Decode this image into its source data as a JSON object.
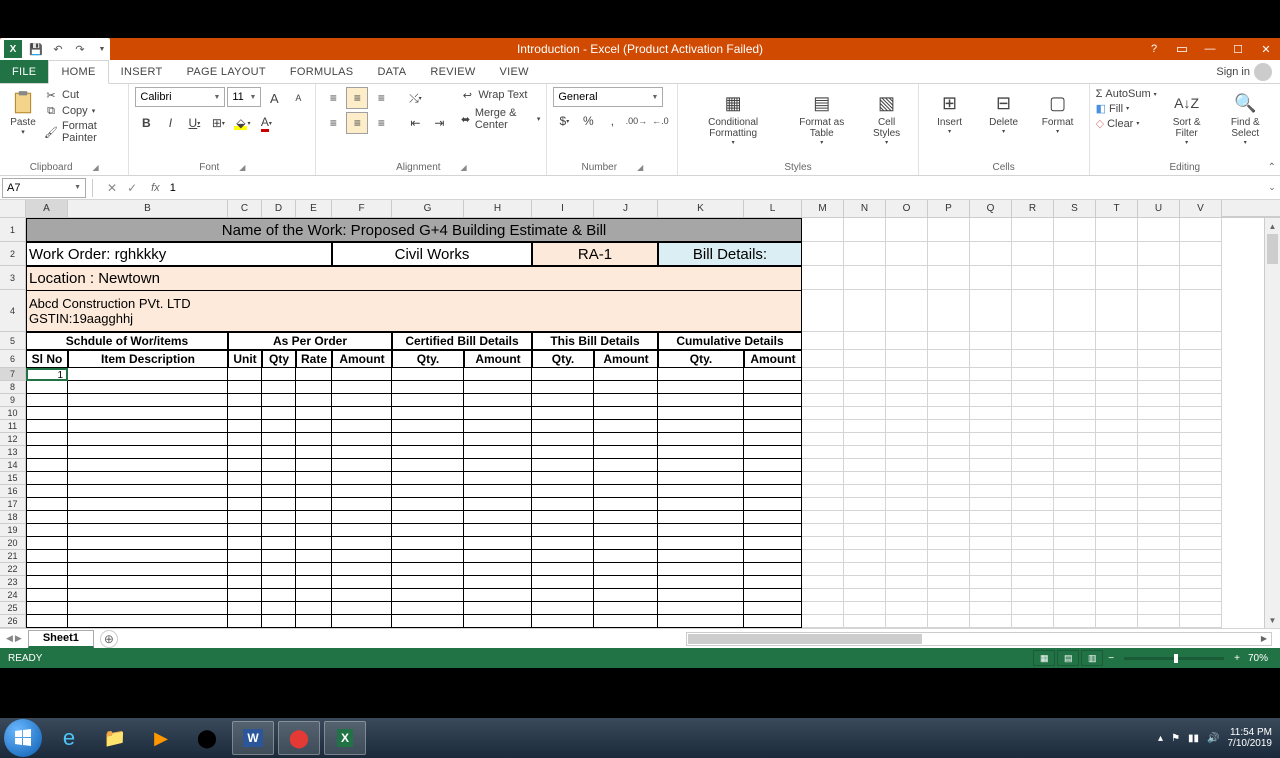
{
  "titlebar": {
    "title": "Introduction  -  Excel (Product Activation Failed)"
  },
  "menubar": {
    "tabs": [
      "FILE",
      "HOME",
      "INSERT",
      "PAGE LAYOUT",
      "FORMULAS",
      "DATA",
      "REVIEW",
      "VIEW"
    ],
    "signin": "Sign in"
  },
  "ribbon": {
    "clipboard": {
      "paste": "Paste",
      "cut": "Cut",
      "copy": "Copy",
      "painter": "Format Painter",
      "label": "Clipboard"
    },
    "font": {
      "name": "Calibri",
      "size": "11",
      "label": "Font"
    },
    "alignment": {
      "wrap": "Wrap Text",
      "merge": "Merge & Center",
      "label": "Alignment"
    },
    "number": {
      "format": "General",
      "label": "Number"
    },
    "styles": {
      "cond": "Conditional Formatting",
      "table": "Format as Table",
      "cell": "Cell Styles",
      "label": "Styles"
    },
    "cells": {
      "insert": "Insert",
      "delete": "Delete",
      "format": "Format",
      "label": "Cells"
    },
    "editing": {
      "autosum": "AutoSum",
      "fill": "Fill",
      "clear": "Clear",
      "sort": "Sort & Filter",
      "find": "Find & Select",
      "label": "Editing"
    }
  },
  "formula": {
    "cellref": "A7",
    "value": "1"
  },
  "columns": [
    "A",
    "B",
    "C",
    "D",
    "E",
    "F",
    "G",
    "H",
    "I",
    "J",
    "K",
    "L",
    "M",
    "N",
    "O",
    "P",
    "Q",
    "R",
    "S",
    "T",
    "U",
    "V"
  ],
  "rows_visible": 27,
  "sheet": {
    "title_row": "Name of the Work: Proposed G+4 Building Estimate & Bill",
    "work_order": "Work Order: rghkkky",
    "civil_works": "Civil Works",
    "ra": "RA-1",
    "bill_details": "Bill Details:",
    "location": "Location : Newtown",
    "company": "Abcd Construction PVt. LTD",
    "gstin": "GSTIN:19aagghhj",
    "hdr1": {
      "schedule": "Schdule of Wor/items",
      "per_order": "As Per Order",
      "certified": "Certified Bill Details",
      "this_bill": "This Bill Details",
      "cumulative": "Cumulative Details"
    },
    "hdr2": {
      "sl": "Sl No",
      "desc": "Item Description",
      "unit": "Unit",
      "qty": "Qty",
      "rate": "Rate",
      "amount": "Amount",
      "qty2": "Qty.",
      "amount2": "Amount"
    },
    "active_value": "1"
  },
  "sheet_tab": "Sheet1",
  "status": {
    "ready": "READY",
    "zoom": "70%"
  },
  "taskbar": {
    "time": "11:54 PM",
    "date": "7/10/2019"
  }
}
